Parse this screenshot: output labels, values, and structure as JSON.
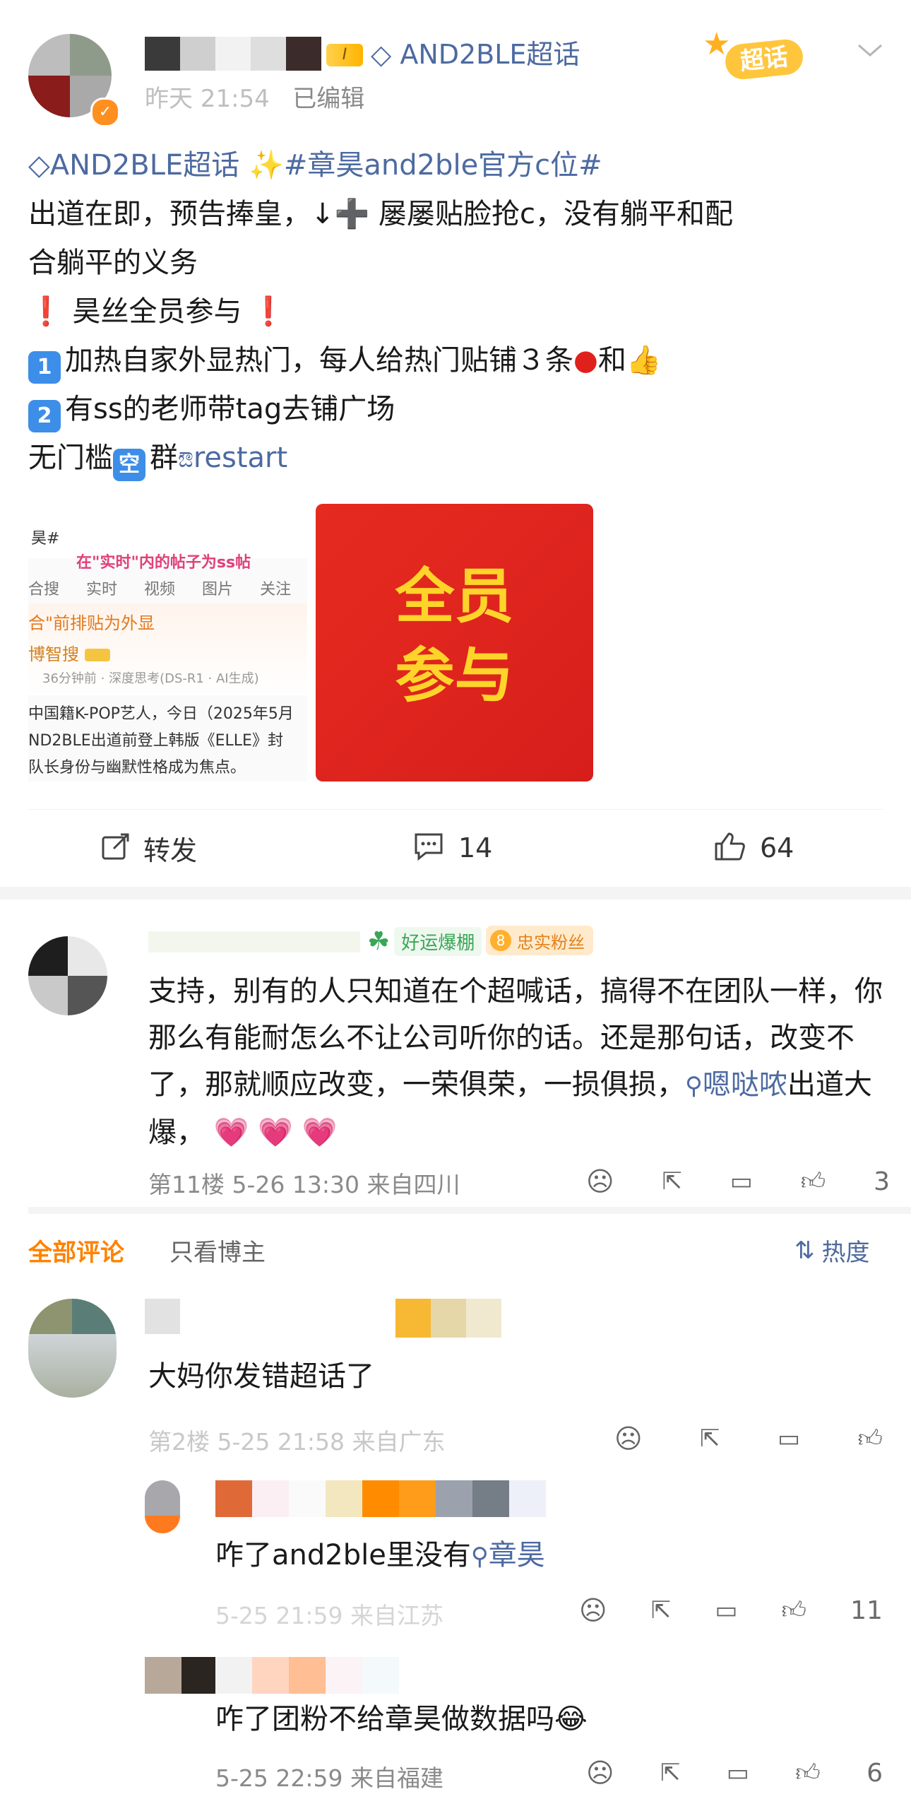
{
  "post": {
    "author_time": "昨天 21:54",
    "edited": "已编辑",
    "supertopic_label": "AND2BLE超话",
    "badge_text": "超话",
    "lines": {
      "line1_topic": "AND2BLE超话",
      "line1_tag": "#章昊and2ble官方c位#",
      "line2": "出道在即，预告捧皇，↓➕ 屡屡贴脸抢c，没有躺平和配",
      "line3": "合躺平的义务",
      "line4": "昊丝全员参与",
      "line5_num": "1",
      "line5": "加热自家外显热门，每人给热门贴铺３条",
      "line5_and": "和",
      "line6_num": "2",
      "line6": "有ss的老师带tag去铺广场",
      "line7_a": "无门槛",
      "line7_box": "空",
      "line7_b": "群",
      "line7_link": "restart"
    },
    "image1": {
      "title": "昊#",
      "pink_caption": "在\"实时\"内的帖子为ss帖",
      "tabs": [
        "合搜",
        "实时",
        "视频",
        "图片",
        "关注"
      ],
      "subtitle": "合\"前排贴为外显",
      "source": "博智搜",
      "meta": "36分钟前 · 深度思考(DS-R1 · AI生成)",
      "body1": "中国籍K-POP艺人，今日（2025年5月",
      "body2": "ND2BLE出道前登上韩版《ELLE》封",
      "body3": "队长身份与幽默性格成为焦点。"
    },
    "image2": {
      "line1": "全员",
      "line2": "参与"
    },
    "actions": {
      "repost": "转发",
      "comments": "14",
      "likes": "64"
    }
  },
  "top_comment": {
    "badge1": "好运爆棚",
    "badge2_num": "8",
    "badge2": "忠实粉丝",
    "text_part1": "支持，别有的人只知道在个超喊话，搞得不在团队一样，你那么有能耐怎么不让公司听你的话。还是那句话，改变不了，那就顺应改变，一荣俱荣，一损俱损，",
    "link": "嗯哒哝",
    "text_part2": "出道大爆，",
    "meta": "第11楼 5-26 13:30 来自四川",
    "likes": "3"
  },
  "tabs": {
    "all": "全部评论",
    "author_only": "只看博主",
    "sort": "热度"
  },
  "comments": [
    {
      "text": "大妈你发错超话了",
      "meta": "第2楼 5-25 21:58 来自广东"
    }
  ],
  "replies": [
    {
      "text": "咋了and2ble里没有",
      "link": "章昊",
      "meta": "5-25 21:59 来自江苏",
      "likes": "11"
    },
    {
      "text": "咋了团粉不给章昊做数据吗",
      "emoji": "😂",
      "meta": "5-25 22:59 来自福建",
      "likes": "6"
    }
  ]
}
